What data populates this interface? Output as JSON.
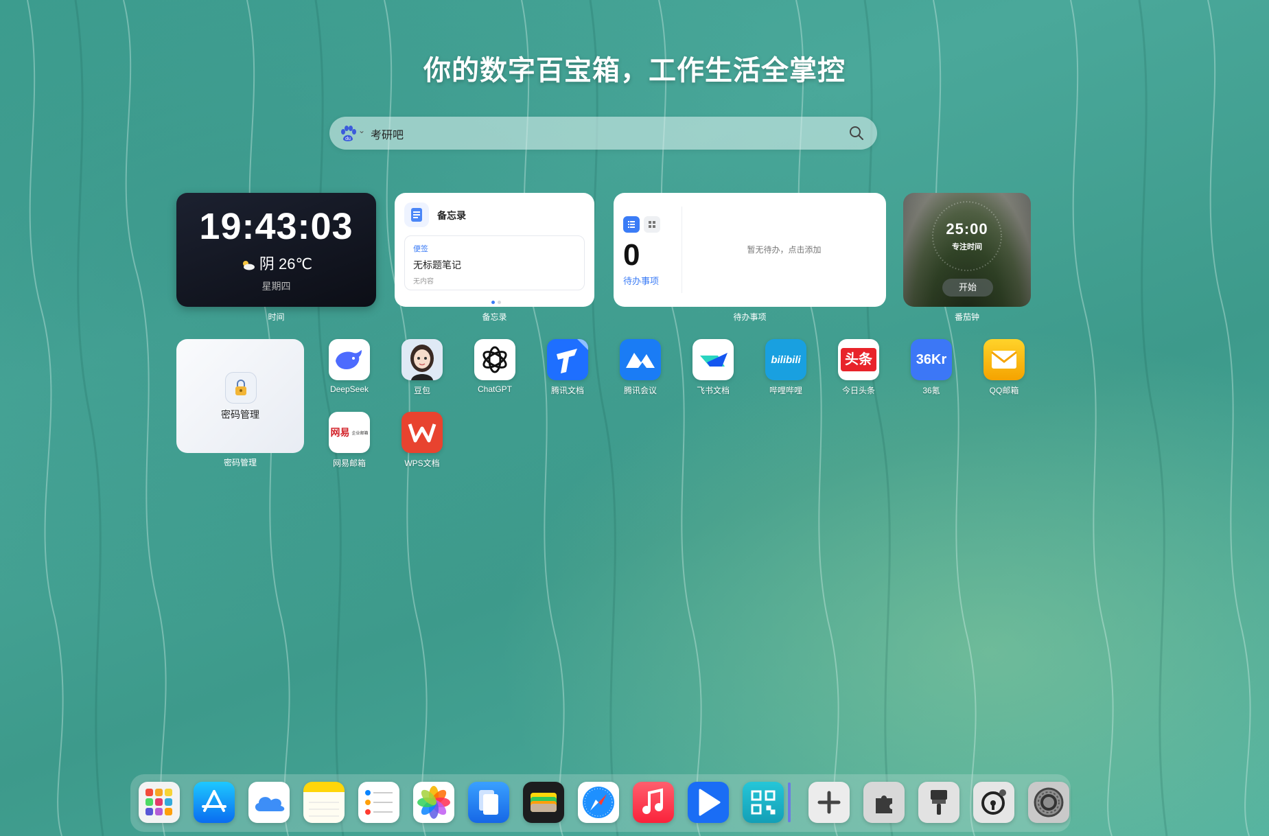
{
  "headline": "你的数字百宝箱，工作生活全掌控",
  "search": {
    "engine_icon": "baidu-paw-icon",
    "value": "考研吧",
    "button_icon": "search-icon"
  },
  "widgets": {
    "clock": {
      "time": "19:43:03",
      "weather": "阴 26℃",
      "weekday": "星期四",
      "label": "时间"
    },
    "memo": {
      "title": "备忘录",
      "note_tag": "便签",
      "note_title": "无标题笔记",
      "note_body": "无内容",
      "label": "备忘录"
    },
    "todo": {
      "count": "0",
      "count_label": "待办事项",
      "empty_text": "暂无待办，点击添加",
      "label": "待办事项"
    },
    "pomodoro": {
      "time": "25:00",
      "subtitle": "专注时间",
      "start": "开始",
      "label": "番茄钟"
    },
    "password": {
      "title": "密码管理",
      "label": "密码管理"
    }
  },
  "apps": [
    {
      "name": "DeepSeek",
      "icon": "deepseek-whale-icon"
    },
    {
      "name": "豆包",
      "icon": "doubao-avatar-icon"
    },
    {
      "name": "ChatGPT",
      "icon": "chatgpt-icon"
    },
    {
      "name": "腾讯文档",
      "icon": "tencent-docs-icon"
    },
    {
      "name": "腾讯会议",
      "icon": "tencent-meeting-icon"
    },
    {
      "name": "飞书文档",
      "icon": "feishu-docs-icon"
    },
    {
      "name": "哔哩哔哩",
      "icon": "bilibili-icon"
    },
    {
      "name": "今日头条",
      "icon": "toutiao-icon"
    },
    {
      "name": "36氪",
      "icon": "36kr-icon"
    },
    {
      "name": "QQ邮箱",
      "icon": "qq-mail-icon"
    },
    {
      "name": "网易邮箱",
      "icon": "netease-mail-icon"
    },
    {
      "name": "WPS文档",
      "icon": "wps-icon"
    }
  ],
  "app_icon_text": {
    "bilibili": "bilibili",
    "toutiao": "头条",
    "kr": "36Kr",
    "netease_brand": "网易",
    "netease_sub": "企业邮箱"
  },
  "dock": [
    {
      "icon": "launchpad-icon"
    },
    {
      "icon": "app-store-icon"
    },
    {
      "icon": "icloud-icon"
    },
    {
      "icon": "notes-icon"
    },
    {
      "icon": "reminders-icon"
    },
    {
      "icon": "photos-icon"
    },
    {
      "icon": "files-icon"
    },
    {
      "icon": "wallet-icon"
    },
    {
      "icon": "safari-icon"
    },
    {
      "icon": "music-icon"
    },
    {
      "icon": "video-player-icon"
    },
    {
      "icon": "qr-code-icon"
    },
    {
      "icon": "add-icon"
    },
    {
      "icon": "extensions-icon"
    },
    {
      "icon": "brush-icon"
    },
    {
      "icon": "privacy-settings-icon"
    },
    {
      "icon": "system-settings-icon"
    }
  ],
  "colors": {
    "accent_blue": "#3b7cf6",
    "clock_bg": "#12151f",
    "widget_bg": "#ffffff",
    "text_white": "#ffffff"
  }
}
